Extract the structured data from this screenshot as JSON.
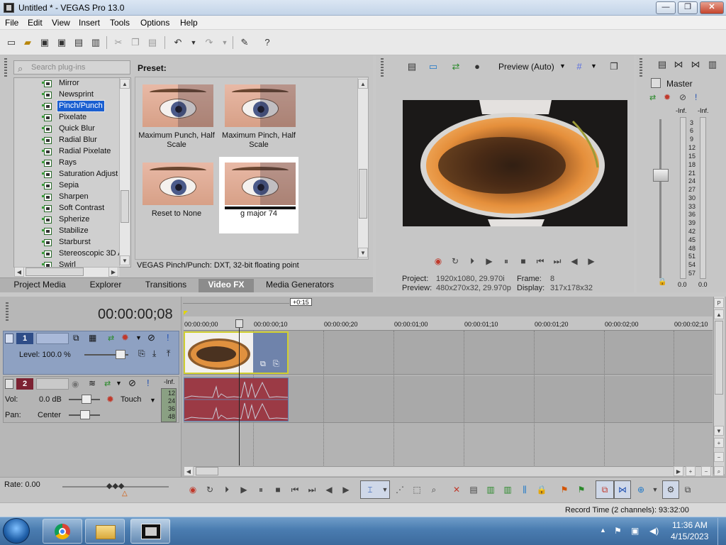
{
  "window": {
    "title": "Untitled * - VEGAS Pro 13.0",
    "buttons": {
      "minimize": "—",
      "maximize": "❐",
      "close": "✕"
    }
  },
  "menu": [
    "File",
    "Edit",
    "View",
    "Insert",
    "Tools",
    "Options",
    "Help"
  ],
  "plugins": {
    "search_placeholder": "Search plug-ins",
    "items": [
      "Mirror",
      "Newsprint",
      "Pinch/Punch",
      "Pixelate",
      "Quick Blur",
      "Radial Blur",
      "Radial Pixelate",
      "Rays",
      "Saturation Adjust",
      "Sepia",
      "Sharpen",
      "Soft Contrast",
      "Spherize",
      "Stabilize",
      "Starburst",
      "Stereoscopic 3D A",
      "Swirl"
    ],
    "selected": "Pinch/Punch"
  },
  "presets": {
    "label": "Preset:",
    "items": [
      {
        "name": "Maximum Punch, Half Scale"
      },
      {
        "name": "Maximum Pinch, Half Scale"
      },
      {
        "name": "Reset to None"
      },
      {
        "name": "g major 74"
      }
    ],
    "status": "VEGAS Pinch/Punch: DXT, 32-bit floating point"
  },
  "tabs": [
    "Project Media",
    "Explorer",
    "Transitions",
    "Video FX",
    "Media Generators"
  ],
  "active_tab": "Video FX",
  "preview": {
    "mode": "Preview (Auto)",
    "project_label": "Project:",
    "project_value": "1920x1080, 29.970i",
    "preview_label": "Preview:",
    "preview_value": "480x270x32, 29.970p",
    "frame_label": "Frame:",
    "frame_value": "8",
    "display_label": "Display:",
    "display_value": "317x178x32"
  },
  "master": {
    "title": "Master",
    "peak_left": "-Inf.",
    "peak_right": "-Inf.",
    "scale": [
      "3",
      "6",
      "9",
      "12",
      "15",
      "18",
      "21",
      "24",
      "27",
      "30",
      "33",
      "36",
      "39",
      "42",
      "45",
      "48",
      "51",
      "54",
      "57"
    ],
    "value_left": "0.0",
    "value_right": "0.0"
  },
  "timeline": {
    "timecode": "00:00:00;08",
    "offset_badge": "+0:15",
    "ruler": [
      "00:00:00;00",
      "00:00:00;10",
      "00:00:00;20",
      "00:00:01;00",
      "00:00:01;10",
      "00:00:01;20",
      "00:00:02;00",
      "00:00:02;10"
    ],
    "track1": {
      "number": "1",
      "level": "Level: 100.0 %"
    },
    "track2": {
      "number": "2",
      "vol_label": "Vol:",
      "vol_value": "0.0 dB",
      "pan_label": "Pan:",
      "pan_value": "Center",
      "automation": "Touch",
      "peak": "-Inf.",
      "meter_ticks": [
        "12",
        "24",
        "36",
        "48"
      ]
    },
    "rate": "Rate: 0.00"
  },
  "statusbar": {
    "record_time": "Record Time (2 channels): 93:32:00"
  },
  "taskbar": {
    "time": "11:36 AM",
    "date": "4/15/2023"
  },
  "colors": {
    "selection": "#1a5fd1",
    "track_video": "#8ea1c2",
    "track_audio": "#9b3a45",
    "accent_clip": "#d0cf30"
  }
}
